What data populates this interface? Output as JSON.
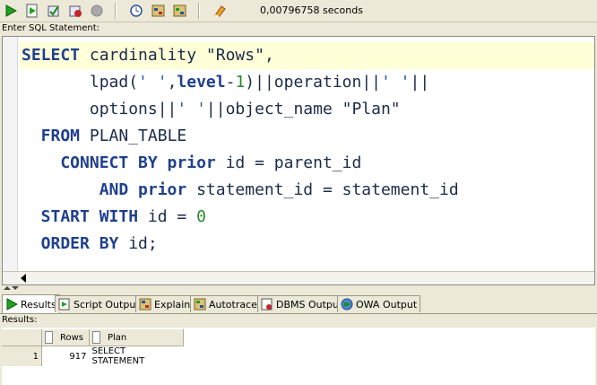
{
  "toolbar": {
    "timing": "0,00796758 seconds",
    "buttons": [
      "run-icon",
      "run-script-icon",
      "commit-icon",
      "rollback-icon",
      "cancel-icon",
      "history-icon",
      "explain-icon",
      "autotrace-icon",
      "clear-icon"
    ]
  },
  "editor": {
    "label": "Enter SQL Statement:",
    "lines": [
      [
        {
          "t": "kw",
          "v": "SELECT"
        },
        {
          "t": "ident",
          "v": " cardinality "
        },
        {
          "t": "ident",
          "v": "\"Rows\","
        }
      ],
      [
        {
          "t": "ident",
          "v": "       lpad("
        },
        {
          "t": "str",
          "v": "' '"
        },
        {
          "t": "ident",
          "v": ","
        },
        {
          "t": "kw",
          "v": "level"
        },
        {
          "t": "ident",
          "v": "-"
        },
        {
          "t": "num",
          "v": "1"
        },
        {
          "t": "ident",
          "v": ")||operation||"
        },
        {
          "t": "str",
          "v": "' '"
        },
        {
          "t": "ident",
          "v": "||"
        }
      ],
      [
        {
          "t": "ident",
          "v": "       options||"
        },
        {
          "t": "str",
          "v": "' '"
        },
        {
          "t": "ident",
          "v": "||object_name \"Plan\""
        }
      ],
      [
        {
          "t": "kw",
          "v": "  FROM"
        },
        {
          "t": "ident",
          "v": " PLAN_TABLE"
        }
      ],
      [
        {
          "t": "kw",
          "v": "    CONNECT BY prior"
        },
        {
          "t": "ident",
          "v": " id = parent_id"
        }
      ],
      [
        {
          "t": "kw",
          "v": "        AND prior"
        },
        {
          "t": "ident",
          "v": " statement_id = statement_id"
        }
      ],
      [
        {
          "t": "kw",
          "v": "  START WITH"
        },
        {
          "t": "ident",
          "v": " id = "
        },
        {
          "t": "num",
          "v": "0"
        }
      ],
      [
        {
          "t": "kw",
          "v": "  ORDER BY"
        },
        {
          "t": "ident",
          "v": " id;"
        }
      ]
    ]
  },
  "tabs": [
    {
      "label": "Results",
      "icon": "results-icon",
      "active": true
    },
    {
      "label": "Script Output",
      "icon": "script-output-icon",
      "active": false
    },
    {
      "label": "Explain",
      "icon": "explain-tab-icon",
      "active": false
    },
    {
      "label": "Autotrace",
      "icon": "autotrace-tab-icon",
      "active": false
    },
    {
      "label": "DBMS Output",
      "icon": "dbms-output-icon",
      "active": false
    },
    {
      "label": "OWA Output",
      "icon": "owa-output-icon",
      "active": false
    }
  ],
  "results": {
    "label": "Results:",
    "columns": [
      "Rows",
      "Plan"
    ],
    "rows": [
      {
        "num": "1",
        "rows": "917",
        "plan": "SELECT STATEMENT"
      }
    ]
  },
  "colors": {
    "keyword": "#1f3f8f",
    "string": "#2a5ea8",
    "number": "#2a8a2a",
    "current_line": "#ffffd8"
  }
}
